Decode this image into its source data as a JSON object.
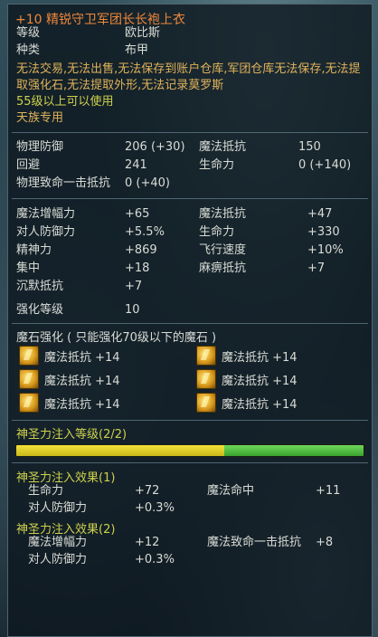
{
  "item": {
    "title": "+10 精锐守卫军团长长袍上衣",
    "info": [
      {
        "label": "等级",
        "value": "欧比斯"
      },
      {
        "label": "种类",
        "value": "布甲"
      }
    ],
    "restrictions": "无法交易,无法出售,无法保存到账户仓库,军团仓库无法保存,无法提取强化石,无法提取外形,无法记录莫罗斯",
    "level_req": "55级以上可以使用",
    "race_req": "天族专用"
  },
  "base_stats": [
    {
      "k1": "物理防御",
      "v1": "206 (+30)",
      "k2": "魔法抵抗",
      "v2": "150"
    },
    {
      "k1": "回避",
      "v1": "241",
      "k2": "生命力",
      "v2": "0 (+140)"
    },
    {
      "k1": "物理致命一击抵抗",
      "v1": "0 (+40)",
      "k2": "",
      "v2": ""
    }
  ],
  "bonus_stats": [
    {
      "k1": "魔法增幅力",
      "v1": "+65",
      "k2": "魔法抵抗",
      "v2": "+47"
    },
    {
      "k1": "对人防御力",
      "v1": "+5.5%",
      "k2": "生命力",
      "v2": "+330"
    },
    {
      "k1": "精神力",
      "v1": "+869",
      "k2": "飞行速度",
      "v2": "+10%"
    },
    {
      "k1": "集中",
      "v1": "+18",
      "k2": "麻痹抵抗",
      "v2": "+7"
    },
    {
      "k1": "沉默抵抗",
      "v1": "+7",
      "k2": "",
      "v2": ""
    }
  ],
  "enhance": {
    "label": "强化等级",
    "value": "10"
  },
  "manastones": {
    "header": "魔石强化 ( 只能强化70级以下的魔石 )",
    "slots": [
      {
        "icon": "manastone-icon",
        "text": "魔法抵抗 +14"
      },
      {
        "icon": "manastone-icon",
        "text": "魔法抵抗 +14"
      },
      {
        "icon": "manastone-icon",
        "text": "魔法抵抗 +14"
      },
      {
        "icon": "manastone-icon",
        "text": "魔法抵抗 +14"
      },
      {
        "icon": "manastone-icon",
        "text": "魔法抵抗 +14"
      },
      {
        "icon": "manastone-icon",
        "text": "魔法抵抗 +14"
      }
    ]
  },
  "godstone": {
    "header": "神圣力注入等级(2/2)",
    "progress": {
      "yellow_fraction": 0.6,
      "green_fraction": 0.4,
      "color_a": "#f4e23a",
      "color_b": "#5ccc48"
    }
  },
  "effects": [
    {
      "header": "神圣力注入效果(1)",
      "rows": [
        {
          "k1": "生命力",
          "v1": "+72",
          "k2": "魔法命中",
          "v2": "+11"
        },
        {
          "k1": "对人防御力",
          "v1": "+0.3%",
          "k2": "",
          "v2": ""
        }
      ]
    },
    {
      "header": "神圣力注入效果(2)",
      "rows": [
        {
          "k1": "魔法增幅力",
          "v1": "+12",
          "k2": "魔法致命一击抵抗",
          "v2": "+8"
        },
        {
          "k1": "对人防御力",
          "v1": "+0.3%",
          "k2": "",
          "v2": ""
        }
      ]
    }
  ],
  "colors": {
    "title": "#f0873a",
    "note": "#e0b35a",
    "god": "#cfd14c"
  }
}
